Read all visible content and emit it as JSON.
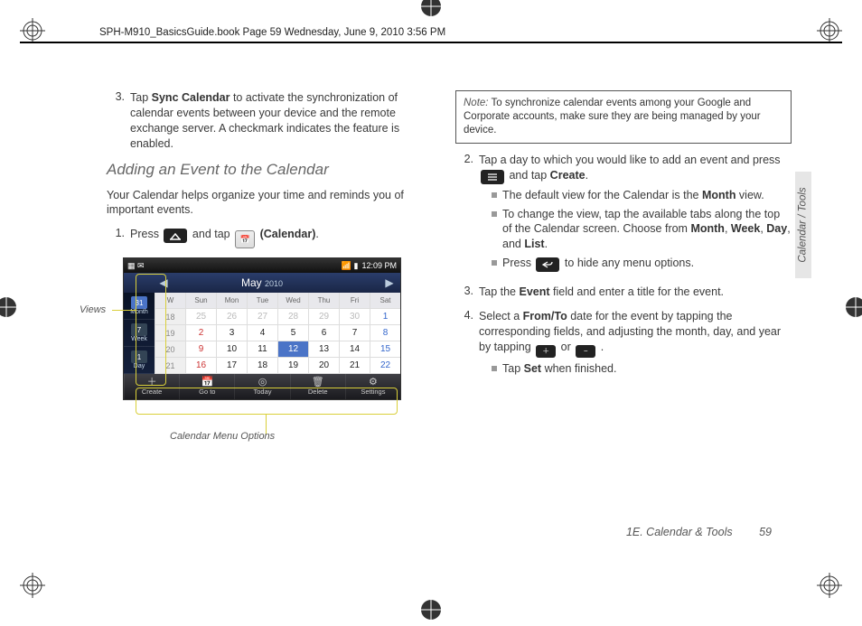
{
  "header_path": "SPH-M910_BasicsGuide.book  Page 59  Wednesday, June 9, 2010  3:56 PM",
  "side_tab": "Calendar / Tools",
  "footer": {
    "section": "1E. Calendar & Tools",
    "page": "59"
  },
  "left": {
    "step3_num": "3.",
    "step3_a": "Tap ",
    "step3_bold": "Sync Calendar",
    "step3_b": " to activate the synchronization of calendar events between your device and the remote exchange server. A checkmark indicates the feature is enabled.",
    "heading": "Adding an Event to the Calendar",
    "intro": "Your Calendar helps organize your time and reminds you of important events.",
    "step1_num": "1.",
    "step1_a": "Press ",
    "step1_b": " and tap ",
    "step1_c": " (Calendar)",
    "step1_d": ".",
    "label_views": "Views",
    "label_menu": "Calendar Menu Options"
  },
  "shot": {
    "status_left": "▦ ✉",
    "status_right_icons": "📶 ▮",
    "status_time": "12:09 PM",
    "title_month": "May",
    "title_year": "2010",
    "view_tabs": [
      {
        "icon": "31",
        "label": "Month"
      },
      {
        "icon": "7",
        "label": "Week"
      },
      {
        "icon": "1",
        "label": "Day"
      }
    ],
    "weekdays": [
      "W",
      "Sun",
      "Mon",
      "Tue",
      "Wed",
      "Thu",
      "Fri",
      "Sat"
    ],
    "rows": [
      {
        "wk": "18",
        "d": [
          "25",
          "26",
          "27",
          "28",
          "29",
          "30",
          "1"
        ],
        "other_until": 5,
        "sat_idx": 6
      },
      {
        "wk": "19",
        "d": [
          "2",
          "3",
          "4",
          "5",
          "6",
          "7",
          "8"
        ],
        "sun_idx": 0,
        "sat_idx": 6
      },
      {
        "wk": "20",
        "d": [
          "9",
          "10",
          "11",
          "12",
          "13",
          "14",
          "15"
        ],
        "sun_idx": 0,
        "sat_idx": 6,
        "sel_idx": 3
      },
      {
        "wk": "21",
        "d": [
          "16",
          "17",
          "18",
          "19",
          "20",
          "21",
          "22"
        ],
        "sun_idx": 0,
        "sat_idx": 6
      }
    ],
    "bottom": [
      {
        "icon": "＋",
        "label": "Create"
      },
      {
        "icon": "📅",
        "label": "Go to"
      },
      {
        "icon": "◎",
        "label": "Today"
      },
      {
        "icon": "🗑",
        "label": "Delete"
      },
      {
        "icon": "⚙",
        "label": "Settings"
      }
    ]
  },
  "right": {
    "note_label": "Note:",
    "note_body": "To synchronize calendar events among your Google and Corporate accounts, make sure they are being managed by your device.",
    "step2_num": "2.",
    "step2_a": "Tap a day to which you would like to add an event and press ",
    "step2_b": " and tap ",
    "step2_c": "Create",
    "step2_d": ".",
    "b1_a": "The default view for the Calendar is the ",
    "b1_b": "Month",
    "b1_c": " view.",
    "b2_a": "To change the view, tap the available tabs along the top of the Calendar screen. Choose from ",
    "b2_b": "Month",
    "b2_c": ", ",
    "b2_d": "Week",
    "b2_e": ", ",
    "b2_f": "Day",
    "b2_g": ", and ",
    "b2_h": "List",
    "b2_i": ".",
    "b3_a": "Press ",
    "b3_b": " to hide any menu options.",
    "step3_num": "3.",
    "step3_a": "Tap the ",
    "step3_b": "Event",
    "step3_c": " field and enter a title for the event.",
    "step4_num": "4.",
    "step4_a": "Select a ",
    "step4_b": "From/To",
    "step4_c": " date for the event by tapping the corresponding fields, and adjusting the month, day, and year by tapping ",
    "step4_d": " or ",
    "step4_e": ".",
    "b4_a": "Tap ",
    "b4_b": "Set",
    "b4_c": " when finished."
  }
}
